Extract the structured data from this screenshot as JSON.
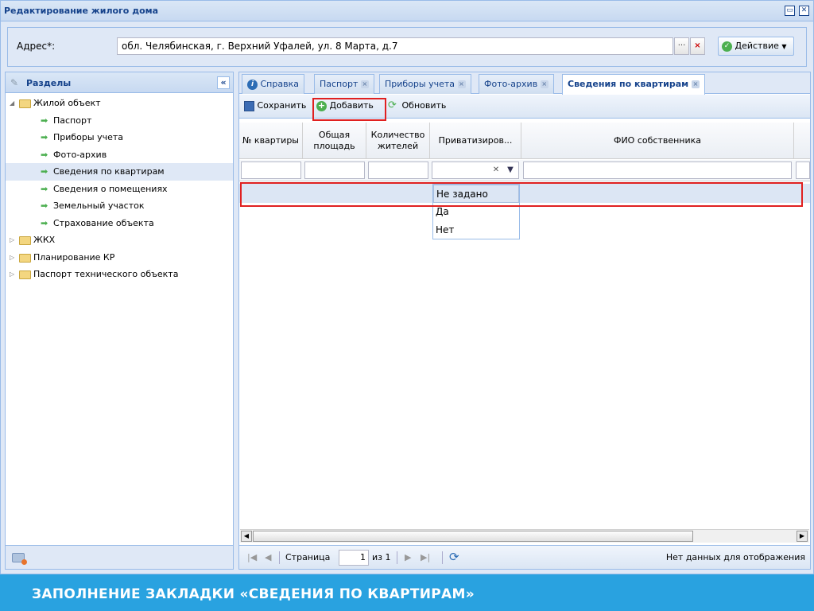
{
  "window": {
    "title": "Редактирование жилого дома"
  },
  "address": {
    "label": "Адрес*:",
    "value": "обл. Челябинская, г. Верхний Уфалей, ул. 8 Марта, д.7",
    "more": "···",
    "clear": "×",
    "action_label": "Действие"
  },
  "sections": {
    "title": "Разделы",
    "collapse": "«",
    "tree": [
      {
        "label": "Жилой объект",
        "kind": "folder",
        "expanded": true
      },
      {
        "label": "Паспорт",
        "kind": "leaf"
      },
      {
        "label": "Приборы учета",
        "kind": "leaf"
      },
      {
        "label": "Фото-архив",
        "kind": "leaf"
      },
      {
        "label": "Сведения по квартирам",
        "kind": "leaf",
        "selected": true
      },
      {
        "label": "Сведения о помещениях",
        "kind": "leaf"
      },
      {
        "label": "Земельный участок",
        "kind": "leaf"
      },
      {
        "label": "Страхование объекта",
        "kind": "leaf"
      },
      {
        "label": "ЖКХ",
        "kind": "folder",
        "expanded": false
      },
      {
        "label": "Планирование КР",
        "kind": "folder",
        "expanded": false
      },
      {
        "label": "Паспорт технического объекта",
        "kind": "folder",
        "expanded": false
      }
    ]
  },
  "tabs": [
    {
      "label": "Справка",
      "closable": false,
      "icon": "info-icon"
    },
    {
      "label": "Паспорт",
      "closable": true
    },
    {
      "label": "Приборы учета",
      "closable": true
    },
    {
      "label": "Фото-архив",
      "closable": true
    },
    {
      "label": "Сведения по квартирам",
      "closable": true,
      "active": true
    }
  ],
  "toolbar": {
    "save": "Сохранить",
    "add": "Добавить",
    "refresh": "Обновить"
  },
  "grid": {
    "columns": [
      "№ квартиры",
      "Общая площадь",
      "Количество жителей",
      "Приватизиров...",
      "ФИО собственника"
    ],
    "rows": []
  },
  "privatized_filter": {
    "value": "",
    "options": [
      "Не задано",
      "Да",
      "Нет"
    ],
    "highlighted": "Не задано"
  },
  "pager": {
    "page_label": "Страница",
    "page": "1",
    "of_label": "из 1",
    "status": "Нет данных для отображения"
  },
  "banner": {
    "text": "ЗАПОЛНЕНИЕ ЗАКЛАДКИ «СВЕДЕНИЯ ПО КВАРТИРАМ»"
  }
}
